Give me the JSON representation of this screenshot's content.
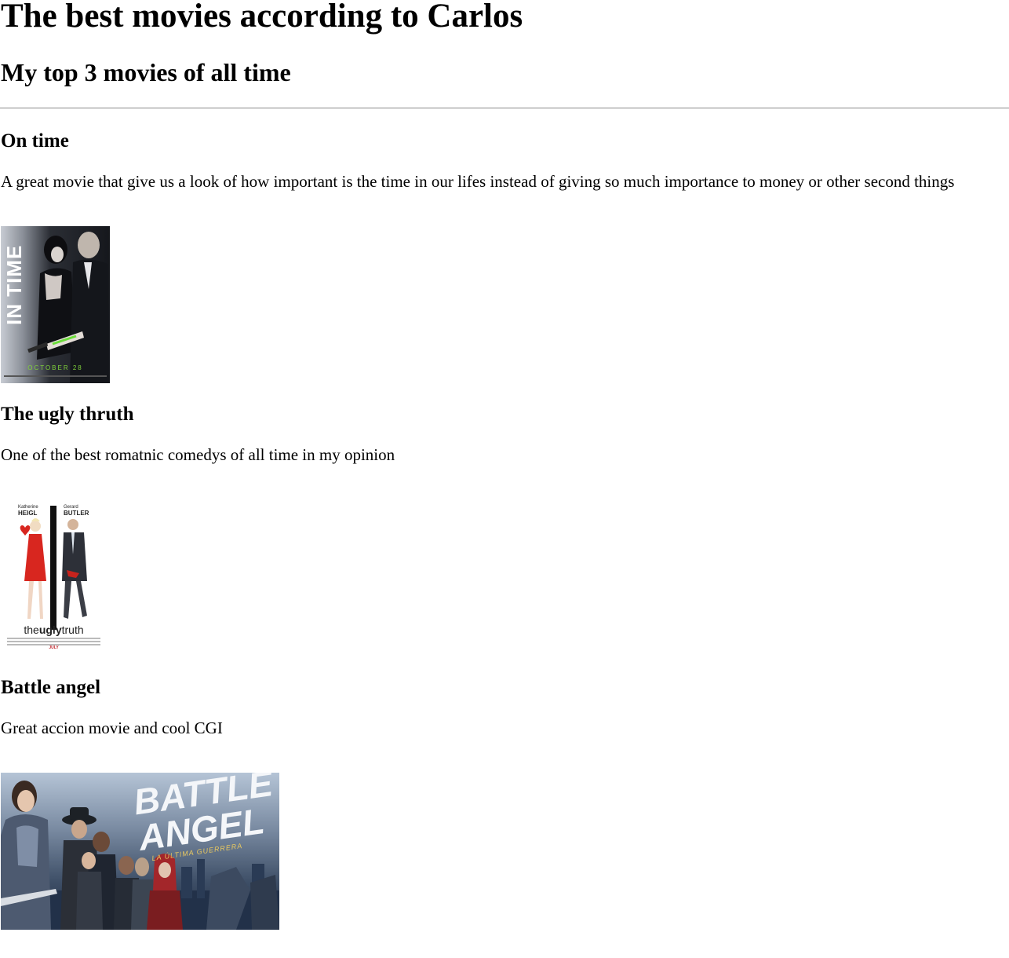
{
  "page": {
    "title": "The best movies according to Carlos",
    "subtitle": "My top 3 movies of all time"
  },
  "movies": [
    {
      "heading": "On time",
      "description": "A great movie that give us a look of how important is the time in our lifes instead of giving so much importance to money or other second things",
      "poster": {
        "title": "IN TIME",
        "date": "OCTOBER 28"
      }
    },
    {
      "heading": "The ugly thruth",
      "description": "One of the best romatnic comedys of all time in my opinion",
      "poster": {
        "actor_1_first": "Katherine",
        "actor_1_last": "HEIGL",
        "actor_2_first": "Gerard",
        "actor_2_last": "BUTLER",
        "title_prefix": "the",
        "title_bold": "ugly",
        "title_suffix": "truth",
        "month": "JULY"
      }
    },
    {
      "heading": "Battle angel",
      "description": "Great accion movie and cool CGI",
      "poster": {
        "title": "BATTLE\nANGEL",
        "subtitle": "LA ÚLTIMA GUERRERA"
      }
    }
  ]
}
